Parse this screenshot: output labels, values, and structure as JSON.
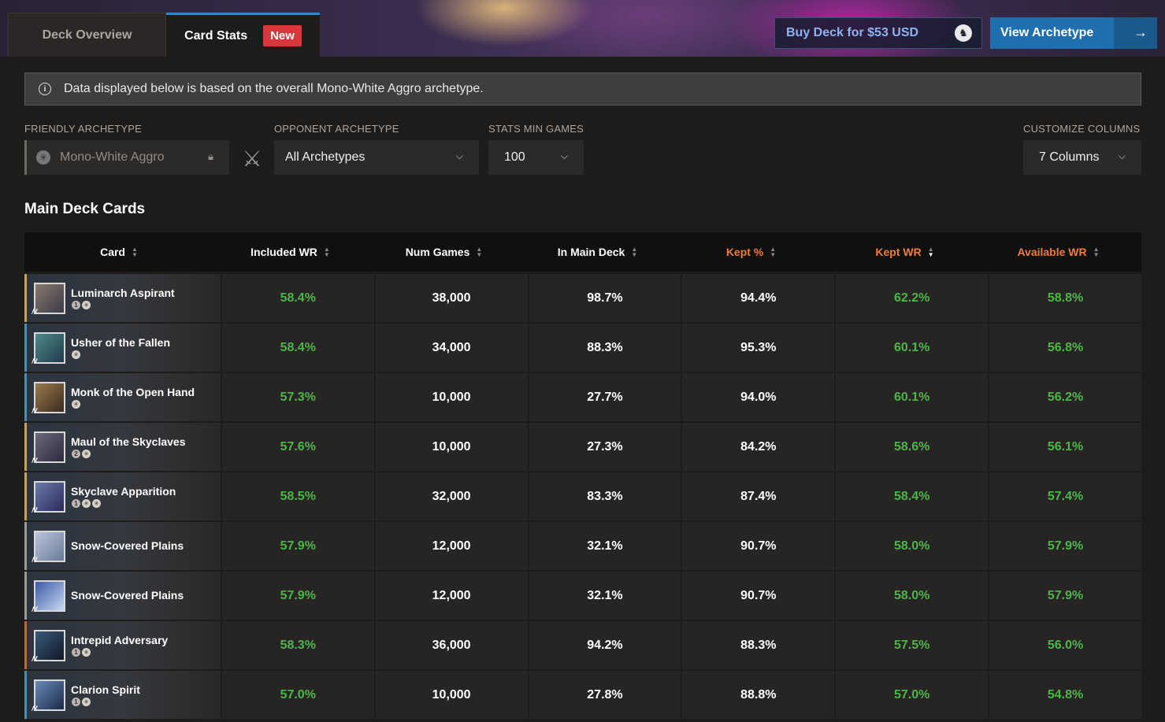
{
  "tabs": [
    {
      "label": "Deck Overview"
    },
    {
      "label": "Card Stats",
      "badge": "New"
    }
  ],
  "header": {
    "buy_label": "Buy Deck for $53 USD",
    "view_label": "View Archetype"
  },
  "info": {
    "text": "Data displayed below is based on the overall Mono-White Aggro archetype."
  },
  "filters": {
    "friendly_label": "FRIENDLY ARCHETYPE",
    "friendly_value": "Mono-White Aggro",
    "opponent_label": "OPPONENT ARCHETYPE",
    "opponent_value": "All Archetypes",
    "min_games_label": "STATS MIN GAMES",
    "min_games_value": "100",
    "columns_label": "CUSTOMIZE COLUMNS",
    "columns_value": "7 Columns"
  },
  "section_title": "Main Deck Cards",
  "table": {
    "columns": [
      "Card",
      "Included WR",
      "Num Games",
      "In Main Deck",
      "Kept %",
      "Kept WR",
      "Available WR"
    ],
    "highlight_color": "#f07b3a",
    "positive_color": "#4cb648",
    "rows": [
      {
        "card": "Luminarch Aspirant",
        "mana": [
          "1",
          "W"
        ],
        "stripe": "#c9a44a",
        "included_wr": "58.4%",
        "num_games": "38,000",
        "in_main": "98.7%",
        "kept_pct": "94.4%",
        "kept_wr": "62.2%",
        "available_wr": "58.8%"
      },
      {
        "card": "Usher of the Fallen",
        "mana": [
          "W"
        ],
        "stripe": "#4a8fb8",
        "included_wr": "58.4%",
        "num_games": "34,000",
        "in_main": "88.3%",
        "kept_pct": "95.3%",
        "kept_wr": "60.1%",
        "available_wr": "56.8%"
      },
      {
        "card": "Monk of the Open Hand",
        "mana": [
          "W"
        ],
        "stripe": "#4a8fb8",
        "included_wr": "57.3%",
        "num_games": "10,000",
        "in_main": "27.7%",
        "kept_pct": "94.0%",
        "kept_wr": "60.1%",
        "available_wr": "56.2%"
      },
      {
        "card": "Maul of the Skyclaves",
        "mana": [
          "2",
          "W"
        ],
        "stripe": "#c9a44a",
        "included_wr": "57.6%",
        "num_games": "10,000",
        "in_main": "27.3%",
        "kept_pct": "84.2%",
        "kept_wr": "58.6%",
        "available_wr": "56.1%"
      },
      {
        "card": "Skyclave Apparition",
        "mana": [
          "1",
          "W",
          "W"
        ],
        "stripe": "#c9a44a",
        "included_wr": "58.5%",
        "num_games": "32,000",
        "in_main": "83.3%",
        "kept_pct": "87.4%",
        "kept_wr": "58.4%",
        "available_wr": "57.4%"
      },
      {
        "card": "Snow-Covered Plains",
        "mana": [],
        "stripe": "#9a9896",
        "included_wr": "57.9%",
        "num_games": "12,000",
        "in_main": "32.1%",
        "kept_pct": "90.7%",
        "kept_wr": "58.0%",
        "available_wr": "57.9%"
      },
      {
        "card": "Snow-Covered Plains",
        "mana": [],
        "stripe": "#9a9896",
        "included_wr": "57.9%",
        "num_games": "12,000",
        "in_main": "32.1%",
        "kept_pct": "90.7%",
        "kept_wr": "58.0%",
        "available_wr": "57.9%"
      },
      {
        "card": "Intrepid Adversary",
        "mana": [
          "1",
          "W"
        ],
        "stripe": "#d0602e",
        "included_wr": "58.3%",
        "num_games": "36,000",
        "in_main": "94.2%",
        "kept_pct": "88.3%",
        "kept_wr": "57.5%",
        "available_wr": "56.0%"
      },
      {
        "card": "Clarion Spirit",
        "mana": [
          "1",
          "W"
        ],
        "stripe": "#4a8fb8",
        "included_wr": "57.0%",
        "num_games": "10,000",
        "in_main": "27.8%",
        "kept_pct": "88.8%",
        "kept_wr": "57.0%",
        "available_wr": "54.8%"
      }
    ]
  }
}
